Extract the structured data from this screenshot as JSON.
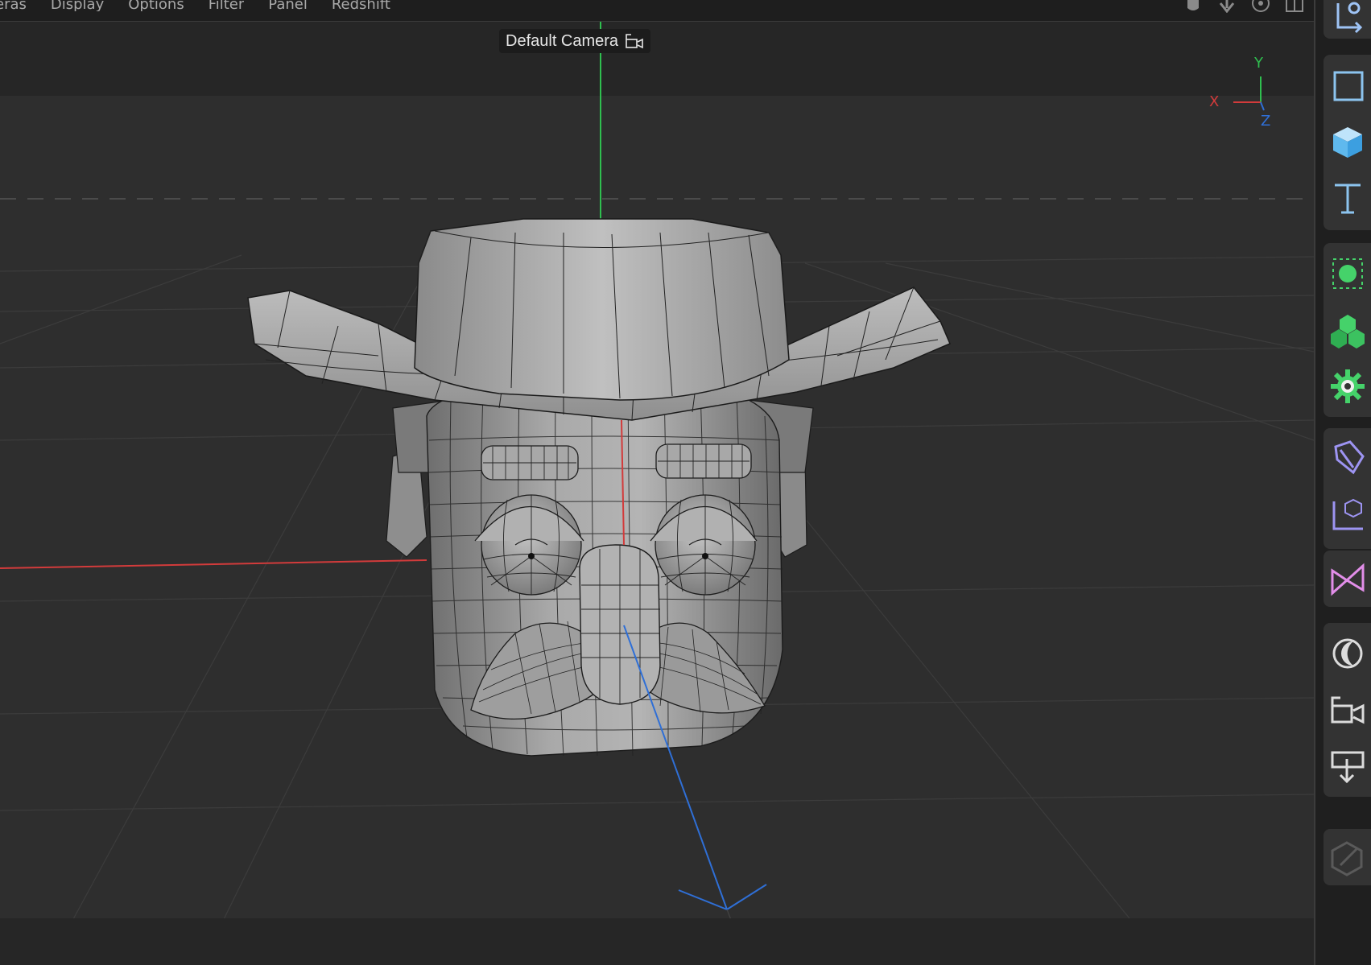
{
  "menubar": {
    "items": [
      "eras",
      "Display",
      "Options",
      "Filter",
      "Panel",
      "Redshift"
    ],
    "nav_icons": [
      "hand-pan-icon",
      "arrow-down-icon",
      "orbit-icon",
      "layout-icon"
    ]
  },
  "viewport": {
    "camera_label": "Default Camera",
    "camera_icon": "camera-icon",
    "axes": {
      "x": "X",
      "y": "Y",
      "z": "Z"
    },
    "colors": {
      "x_axis": "#e03a3a",
      "y_axis": "#2fbf4f",
      "z_axis": "#2f6fd6",
      "mesh": "#9a9a9a",
      "wire": "#1b1b1b"
    }
  },
  "right_toolbar": {
    "tools": [
      "coordinate-system-icon",
      "frame-icon",
      "cube-icon",
      "text-icon",
      "light-icon",
      "cloner-icon",
      "gear-icon",
      "spline-pen-icon",
      "null-object-icon",
      "deformer-icon",
      "environment-icon",
      "camera-icon",
      "floor-icon",
      "edit-icon"
    ]
  }
}
